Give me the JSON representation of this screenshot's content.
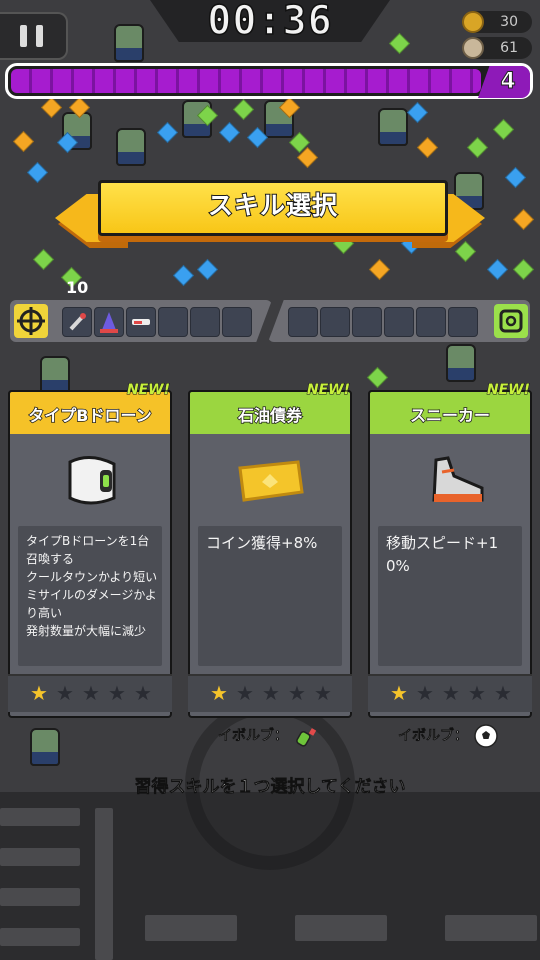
{
  "hud": {
    "timer": "00:36",
    "coins": "30",
    "kills": "61",
    "level": "4",
    "xp_progress": 0.9
  },
  "banner": {
    "title": "スキル選択"
  },
  "slots": {
    "weapons": [
      "drone-missile-icon",
      "traffic-cone-icon",
      "shotgun-icon",
      "empty",
      "empty",
      "empty"
    ],
    "passives": [
      "empty",
      "empty",
      "empty",
      "empty",
      "empty",
      "empty"
    ]
  },
  "cards": [
    {
      "new_label": "NEW!",
      "name": "タイプBドローン",
      "header_color": "#f5c228",
      "icon": "drone-b-icon",
      "description": "タイプBドローンを1台召喚する\nクールタウンかより短い\nミサイルのダメージかより高い\n発射数量が大幅に減少",
      "stars_filled": 1,
      "stars_total": 5
    },
    {
      "new_label": "NEW!",
      "name": "石油債券",
      "header_color": "#9bd640",
      "icon": "gold-ticket-icon",
      "description": "コイン獲得+8%",
      "stars_filled": 1,
      "stars_total": 5,
      "evolve_label": "イボルブ：",
      "evolve_icon": "bottle-icon"
    },
    {
      "new_label": "NEW!",
      "name": "スニーカー",
      "header_color": "#9bd640",
      "icon": "sneaker-icon",
      "description": "移動スピード+10%",
      "stars_filled": 1,
      "stars_total": 5,
      "evolve_label": "イボルブ：",
      "evolve_icon": "soccer-ball-icon"
    }
  ],
  "footer": {
    "message": "習得スキルを１つ選択してください"
  },
  "field": {
    "damage_number": "10"
  }
}
